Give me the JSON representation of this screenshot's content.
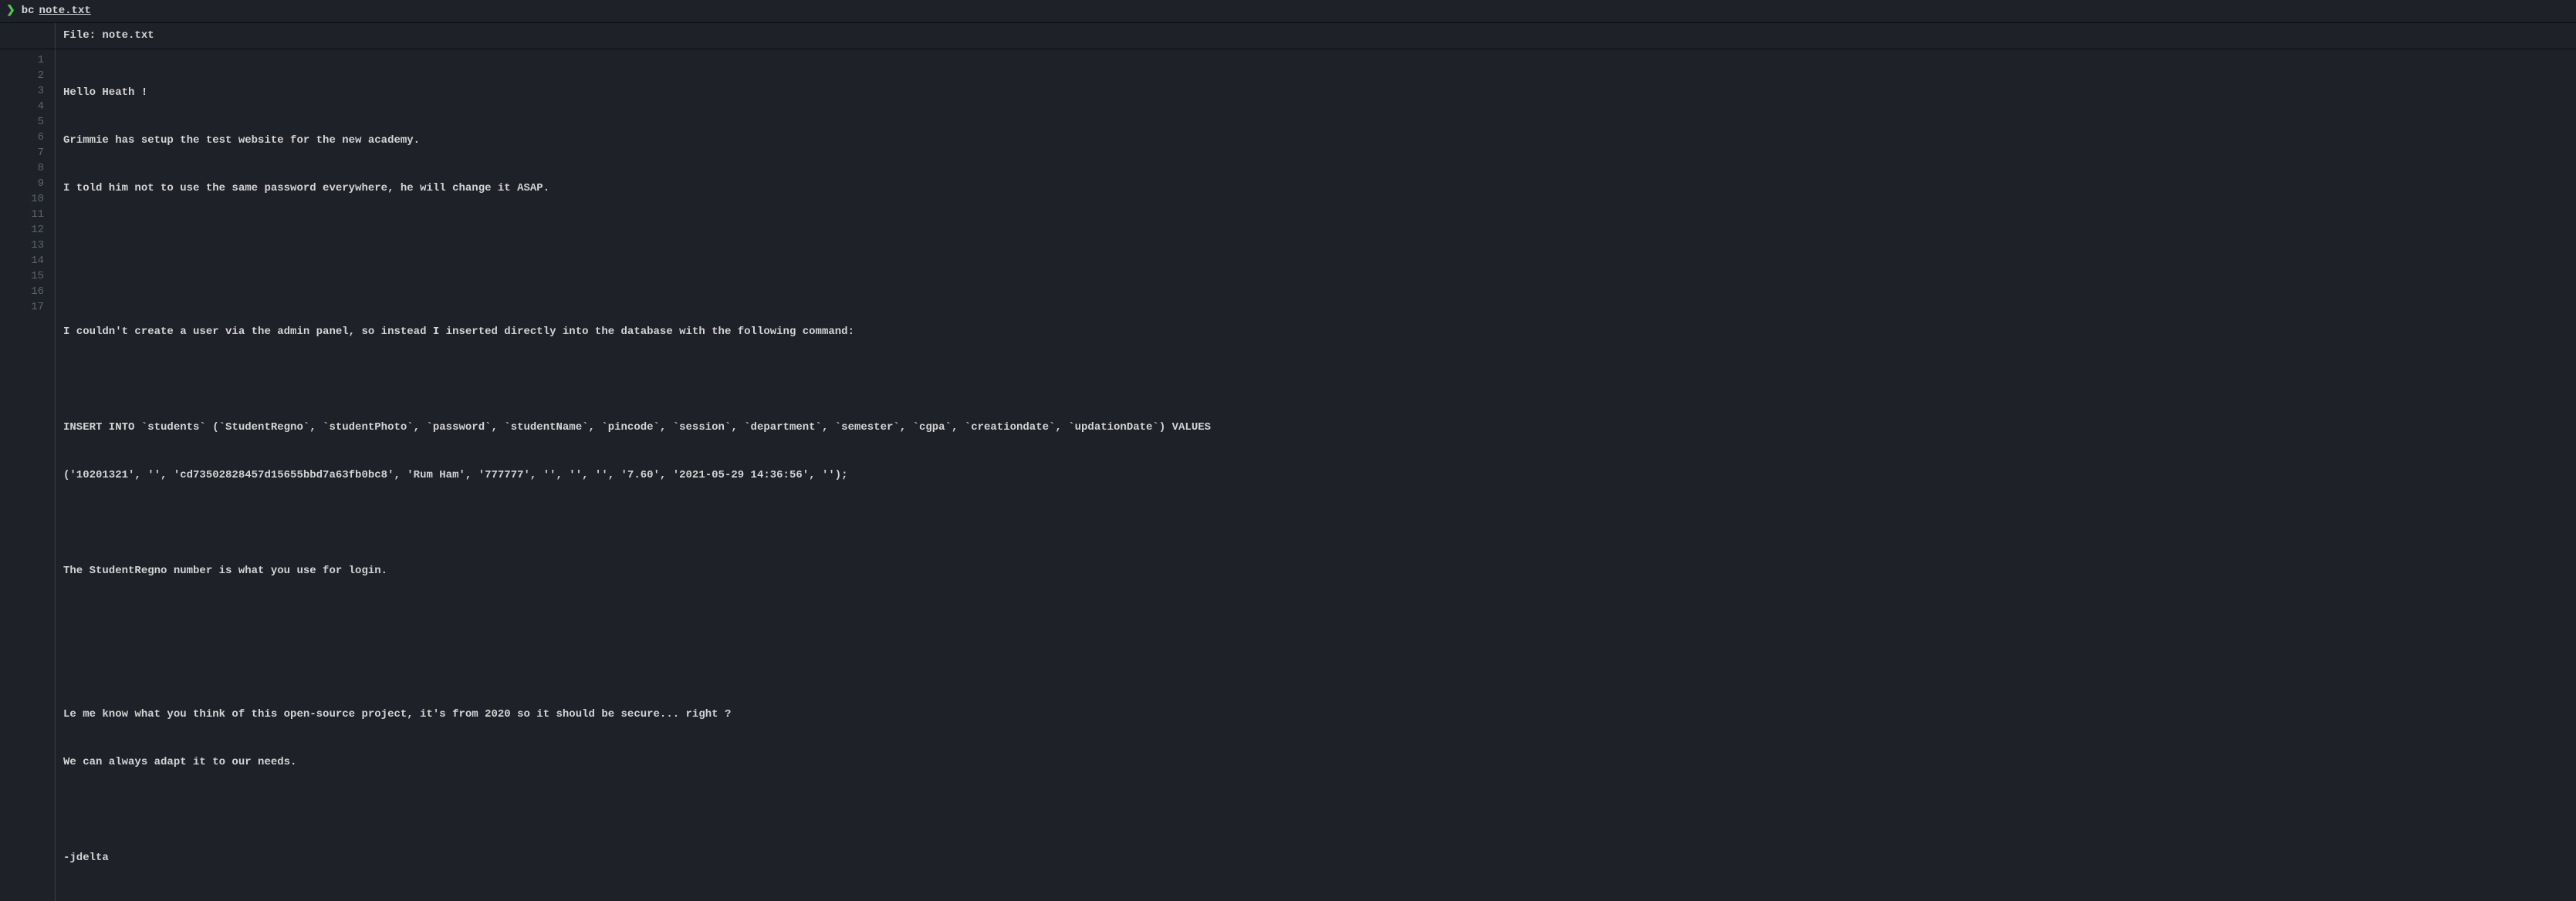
{
  "prompt": {
    "symbol": "❯",
    "command": "bc",
    "argument": "note.txt"
  },
  "file_header": {
    "label": "File:",
    "name": "note.txt"
  },
  "lines": [
    "Hello Heath !",
    "Grimmie has setup the test website for the new academy.",
    "I told him not to use the same password everywhere, he will change it ASAP.",
    "",
    "",
    "I couldn't create a user via the admin panel, so instead I inserted directly into the database with the following command:",
    "",
    "INSERT INTO `students` (`StudentRegno`, `studentPhoto`, `password`, `studentName`, `pincode`, `session`, `department`, `semester`, `cgpa`, `creationdate`, `updationDate`) VALUES",
    "('10201321', '', 'cd73502828457d15655bbd7a63fb0bc8', 'Rum Ham', '777777', '', '', '', '7.60', '2021-05-29 14:36:56', '');",
    "",
    "The StudentRegno number is what you use for login.",
    "",
    "",
    "Le me know what you think of this open-source project, it's from 2020 so it should be secure... right ?",
    "We can always adapt it to our needs.",
    "",
    "-jdelta"
  ],
  "line_numbers": [
    "1",
    "2",
    "3",
    "4",
    "5",
    "6",
    "7",
    "8",
    "9",
    "10",
    "11",
    "12",
    "13",
    "14",
    "15",
    "16",
    "17"
  ]
}
